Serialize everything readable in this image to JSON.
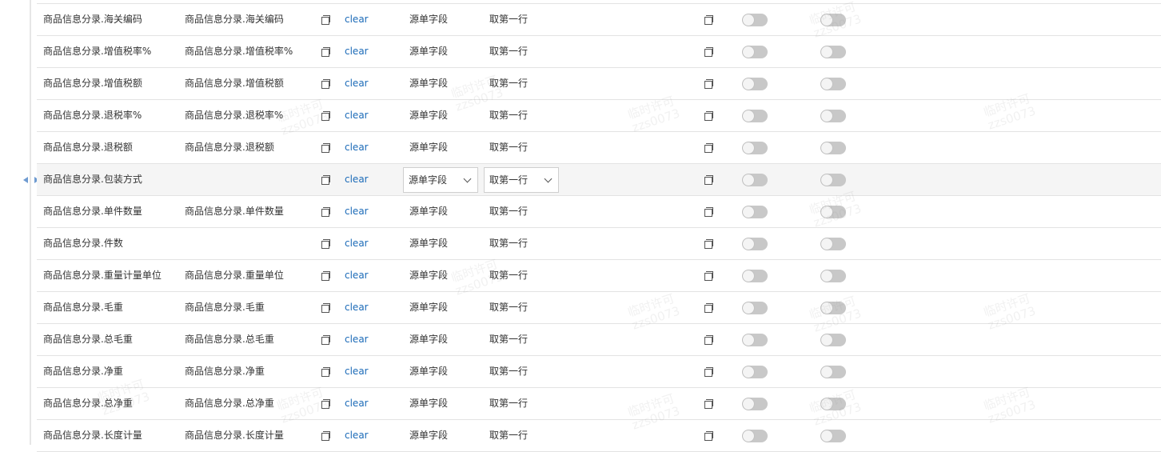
{
  "clear_label": "clear",
  "watermark": {
    "line1": "临时许可",
    "line2": "zzs0073"
  },
  "rows": [
    {
      "source": "商品信息分录.海关编码",
      "target": "商品信息分录.海关编码",
      "value_type": "源单字段",
      "rule": "取第一行"
    },
    {
      "source": "商品信息分录.增值税率%",
      "target": "商品信息分录.增值税率%",
      "value_type": "源单字段",
      "rule": "取第一行"
    },
    {
      "source": "商品信息分录.增值税额",
      "target": "商品信息分录.增值税额",
      "value_type": "源单字段",
      "rule": "取第一行"
    },
    {
      "source": "商品信息分录.退税率%",
      "target": "商品信息分录.退税率%",
      "value_type": "源单字段",
      "rule": "取第一行"
    },
    {
      "source": "商品信息分录.退税额",
      "target": "商品信息分录.退税额",
      "value_type": "源单字段",
      "rule": "取第一行"
    },
    {
      "source": "商品信息分录.包装方式",
      "target": "",
      "value_type": "源单字段",
      "rule": "取第一行",
      "selected": true
    },
    {
      "source": "商品信息分录.单件数量",
      "target": "商品信息分录.单件数量",
      "value_type": "源单字段",
      "rule": "取第一行"
    },
    {
      "source": "商品信息分录.件数",
      "target": "",
      "value_type": "源单字段",
      "rule": "取第一行"
    },
    {
      "source": "商品信息分录.重量计量单位",
      "target": "商品信息分录.重量单位",
      "value_type": "源单字段",
      "rule": "取第一行"
    },
    {
      "source": "商品信息分录.毛重",
      "target": "商品信息分录.毛重",
      "value_type": "源单字段",
      "rule": "取第一行"
    },
    {
      "source": "商品信息分录.总毛重",
      "target": "商品信息分录.总毛重",
      "value_type": "源单字段",
      "rule": "取第一行"
    },
    {
      "source": "商品信息分录.净重",
      "target": "商品信息分录.净重",
      "value_type": "源单字段",
      "rule": "取第一行"
    },
    {
      "source": "商品信息分录.总净重",
      "target": "商品信息分录.总净重",
      "value_type": "源单字段",
      "rule": "取第一行"
    },
    {
      "source": "商品信息分录.长度计量",
      "target": "商品信息分录.长度计量",
      "value_type": "源单字段",
      "rule": "取第一行"
    }
  ]
}
